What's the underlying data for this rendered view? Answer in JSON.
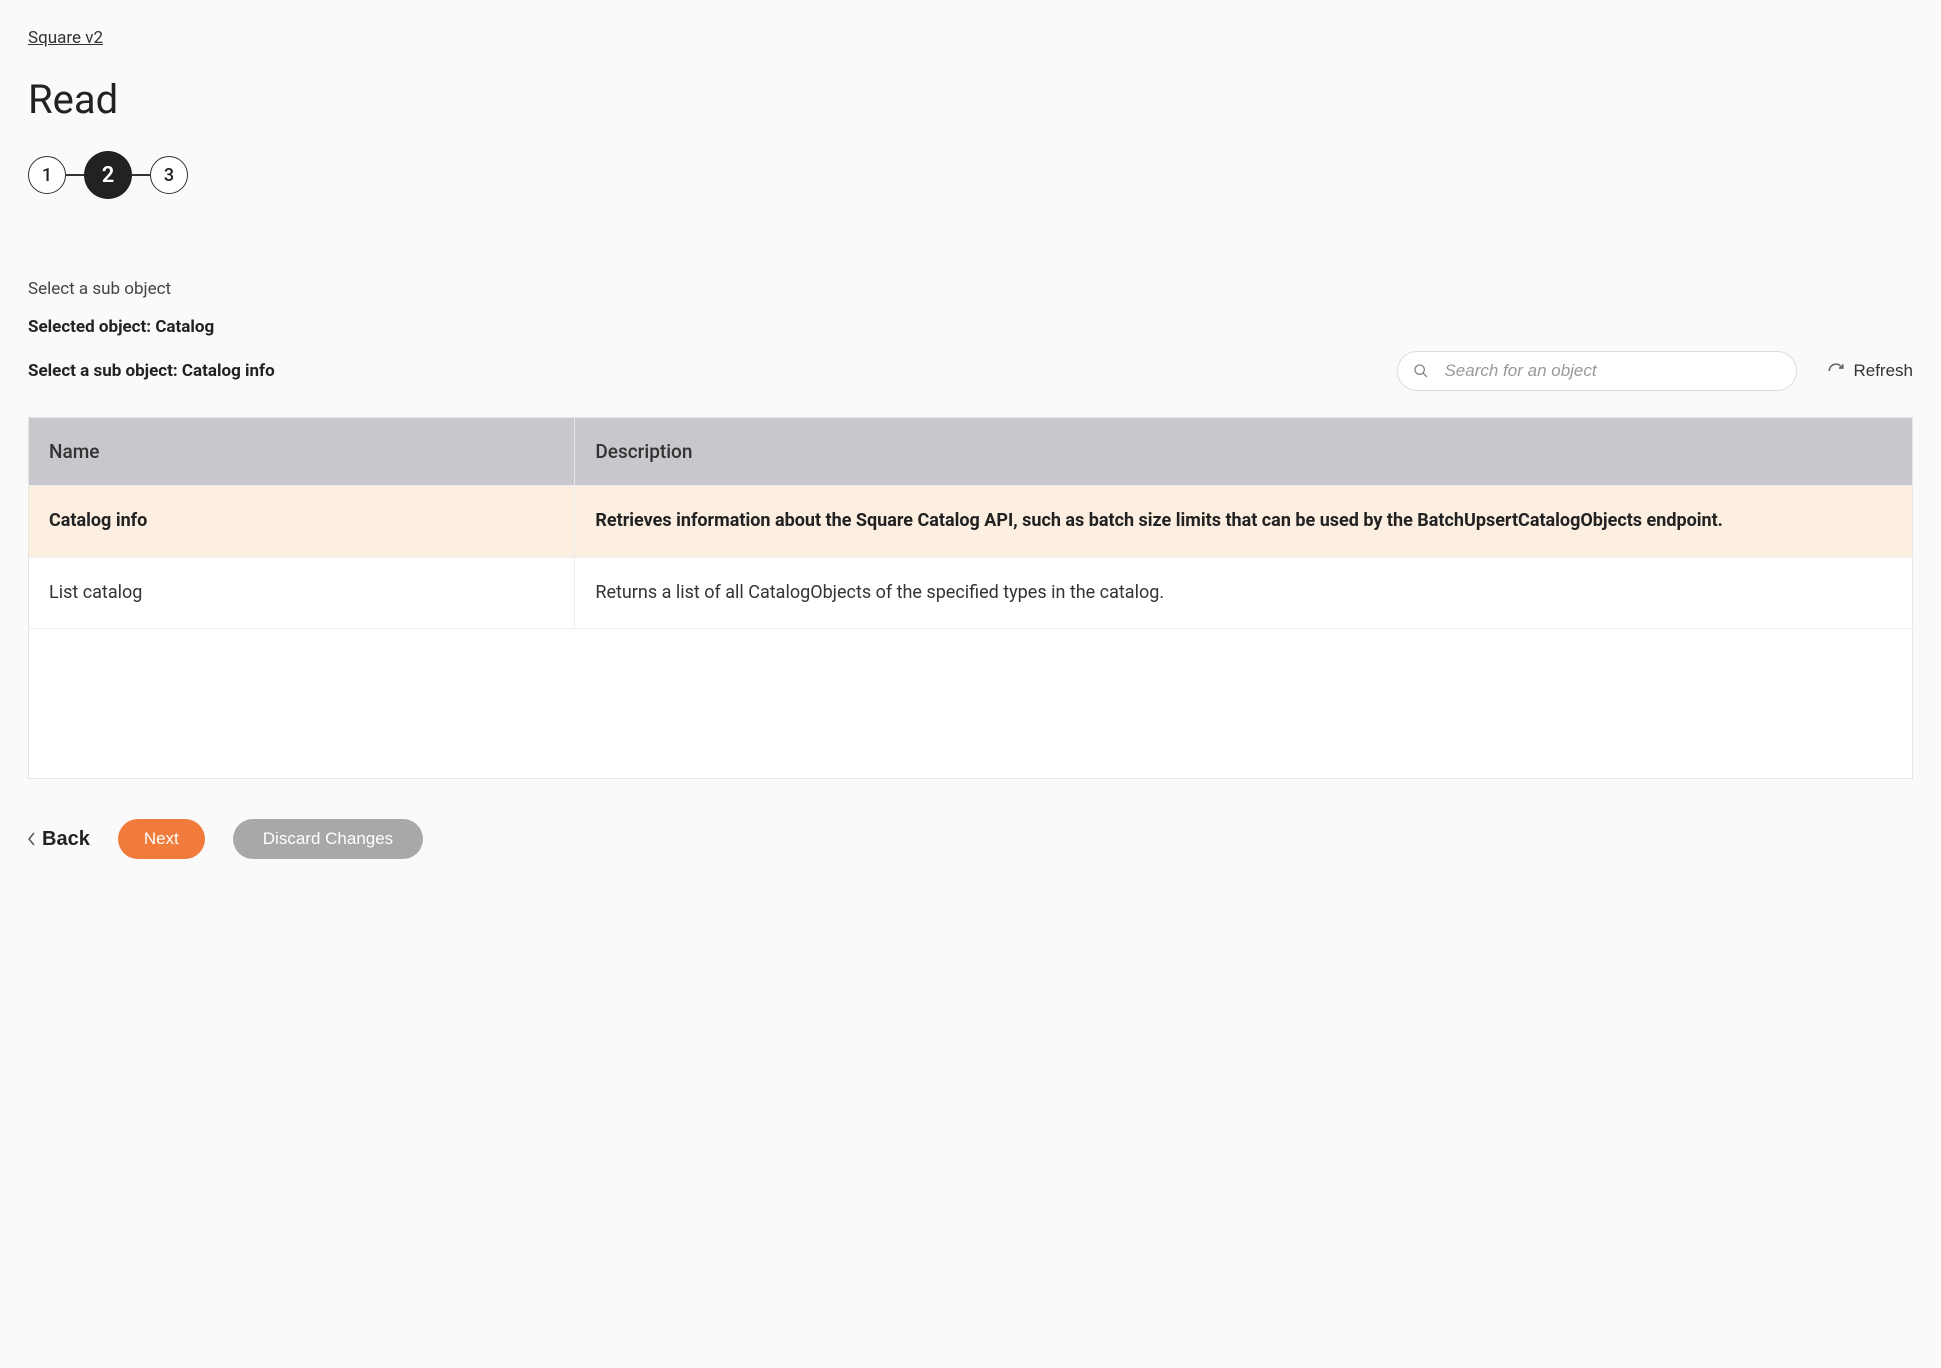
{
  "breadcrumb": "Square v2",
  "page_title": "Read",
  "stepper": {
    "steps": [
      "1",
      "2",
      "3"
    ],
    "active_index": 1
  },
  "sub": {
    "heading": "Select a sub object",
    "selected_object_label": "Selected object: ",
    "selected_object_value": "Catalog",
    "selected_sub_label": "Select a sub object: ",
    "selected_sub_value": "Catalog info"
  },
  "search": {
    "placeholder": "Search for an object"
  },
  "refresh": {
    "label": "Refresh"
  },
  "table": {
    "headers": {
      "name": "Name",
      "description": "Description"
    },
    "rows": [
      {
        "name": "Catalog info",
        "description": "Retrieves information about the Square Catalog API, such as batch size limits that can be used by the BatchUpsertCatalogObjects endpoint.",
        "selected": true
      },
      {
        "name": "List catalog",
        "description": "Returns a list of all CatalogObjects of the specified types in the catalog.",
        "selected": false
      }
    ]
  },
  "actions": {
    "back": "Back",
    "next": "Next",
    "discard": "Discard Changes"
  }
}
